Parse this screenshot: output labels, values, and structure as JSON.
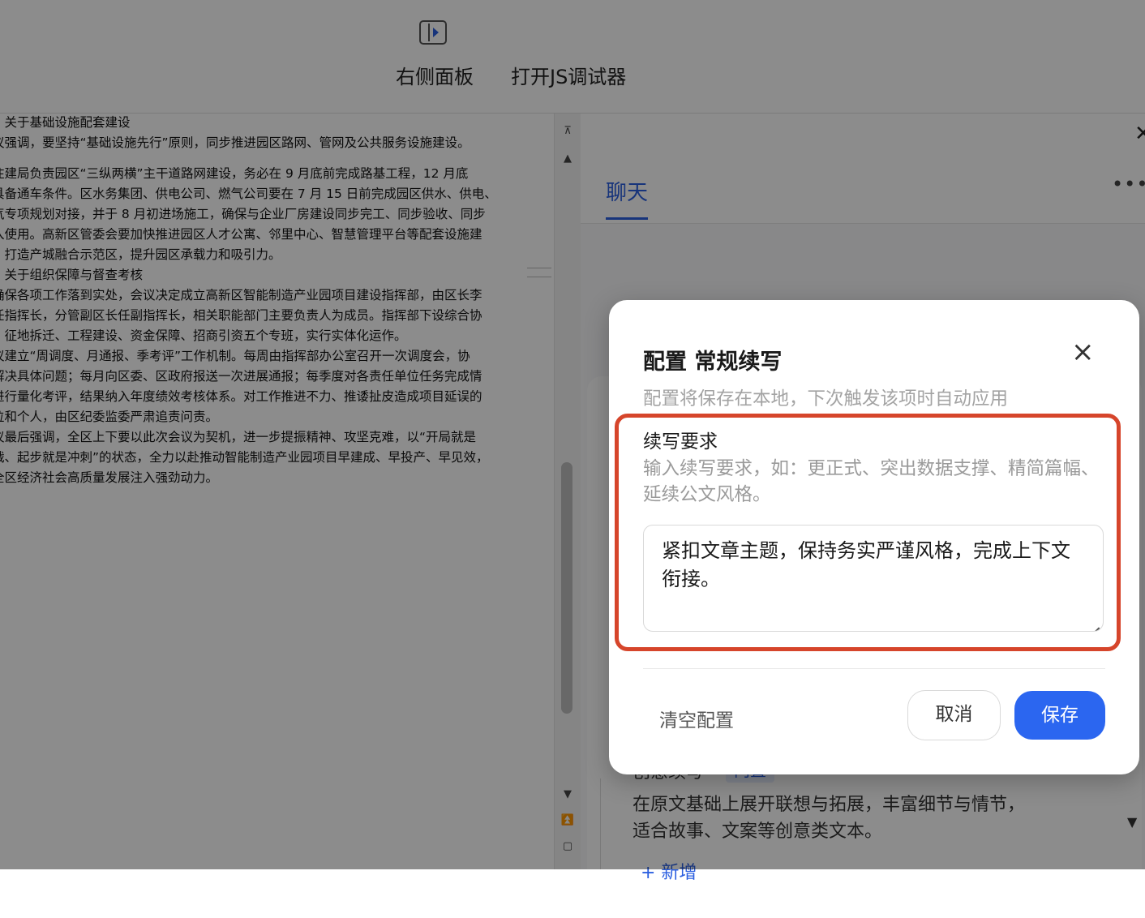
{
  "toolbar": {
    "items": [
      {
        "label": "右侧面板",
        "icon": "right-panel-icon"
      },
      {
        "label": "打开JS调试器"
      }
    ]
  },
  "document": {
    "lines": [
      "、关于基础设施配套建设",
      "议强调，要坚持“基础设施先行”原则，同步推进园区路网、管网及公共服务设施建设。",
      "住建局负责园区“三纵两横”主干道路网建设，务必在 9 月底前完成路基工程，12 月底",
      "具备通车条件。区水务集团、供电公司、燃气公司要在 7 月 15 日前完成园区供水、供电、",
      "气专项规划对接，并于 8 月初进场施工，确保与企业厂房建设同步完工、同步验收、同步",
      "入使用。高新区管委会要加快推进园区人才公寓、邻里中心、智慧管理平台等配套设施建",
      "，打造产城融合示范区，提升园区承载力和吸引力。",
      "、关于组织保障与督查考核",
      "确保各项工作落到实处，会议决定成立高新区智能制造产业园项目建设指挥部，由区长李",
      "任指挥长，分管副区长任副指挥长，相关职能部门主要负责人为成员。指挥部下设综合协",
      "、征地拆迁、工程建设、资金保障、招商引资五个专班，实行实体化运作。",
      "议建立“周调度、月通报、季考评”工作机制。每周由指挥部办公室召开一次调度会，协",
      "解决具体问题；每月向区委、区政府报送一次进展通报；每季度对各责任单位任务完成情",
      "进行量化考评，结果纳入年度绩效考核体系。对工作推进不力、推诿扯皮造成项目延误的",
      "位和个人，由区纪委监委严肃追责问责。",
      "议最后强调，全区上下要以此次会议为契机，进一步提振精神、攻坚克难，以“开局就是",
      "战、起步就是冲刺”的状态，全力以赴推动智能制造产业园项目早建成、早投产、早见效，",
      "全区经济社会高质量发展注入强劲动力。"
    ]
  },
  "right_panel": {
    "tab_chat": "聊天",
    "under_item_title": "创意续写",
    "under_item_badge": "内置",
    "under_item_desc": "在原文基础上展开联想与拓展，丰富细节与情节，适合故事、文案等创意类文本。",
    "under_new": "+ 新增"
  },
  "dialog": {
    "title": "配置 常规续写",
    "subtitle": "配置将保存在本地，下次触发该项时自动应用",
    "field_label": "续写要求",
    "field_hint": "输入续写要求，如：更正式、突出数据支撑、精简篇幅、延续公文风格。",
    "field_value": "紧扣文章主题，保持务实严谨风格，完成上下文衔接。",
    "clear_label": "清空配置",
    "cancel_label": "取消",
    "save_label": "保存",
    "highlight_color": "#d6452b",
    "primary_color": "#2b66f0"
  }
}
